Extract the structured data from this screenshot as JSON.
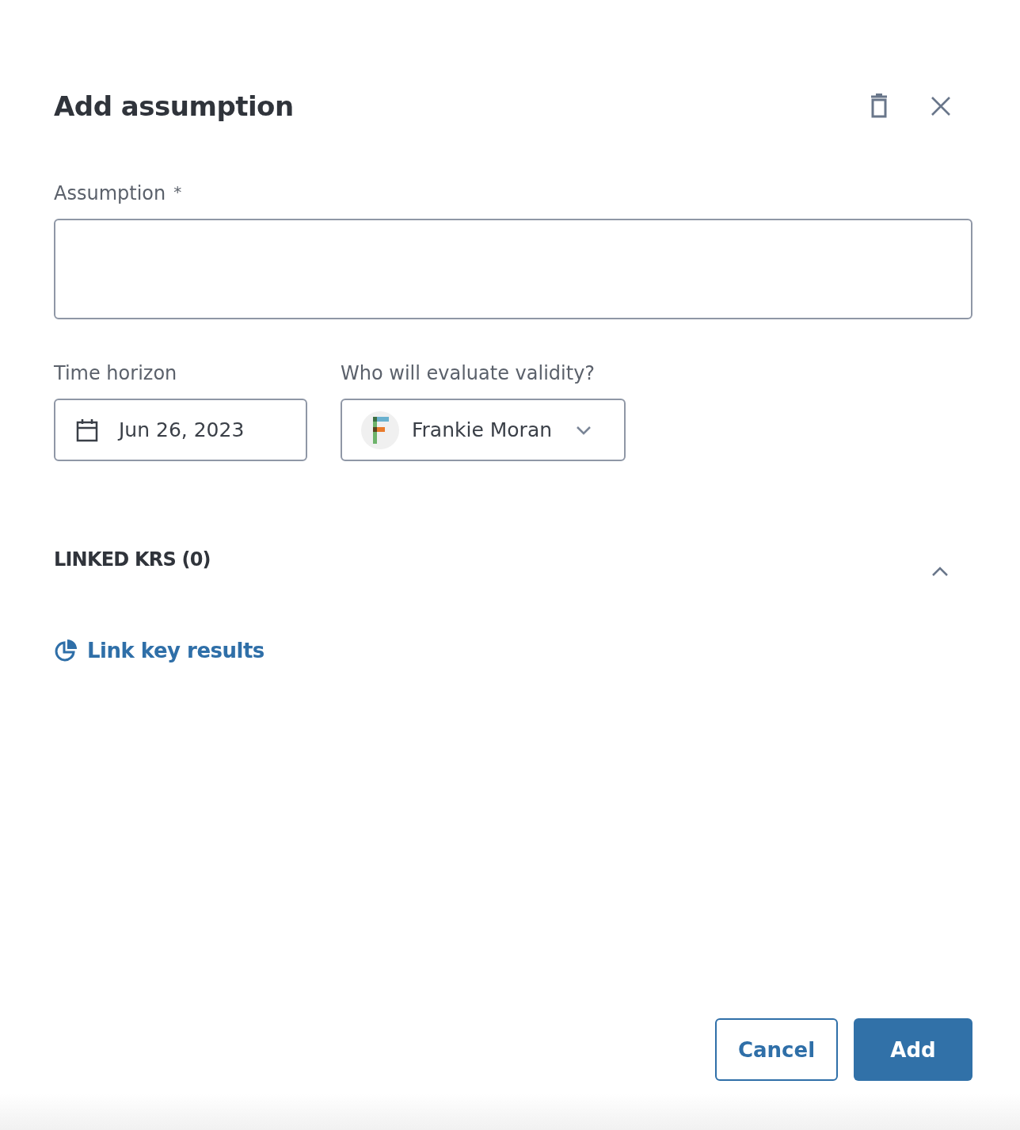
{
  "dialog": {
    "title": "Add assumption"
  },
  "assumption": {
    "label": "Assumption",
    "required_mark": "*"
  },
  "time_horizon": {
    "label": "Time horizon",
    "value": "Jun 26, 2023"
  },
  "evaluator": {
    "label": "Who will evaluate validity?",
    "value": "Frankie Moran"
  },
  "linked_krs": {
    "title": "LINKED KRS (0)",
    "expanded": true,
    "link": "Link key results"
  },
  "buttons": [
    {
      "label": "Cancel",
      "kind": "secondary"
    },
    {
      "label": "Add",
      "kind": "primary"
    }
  ]
}
